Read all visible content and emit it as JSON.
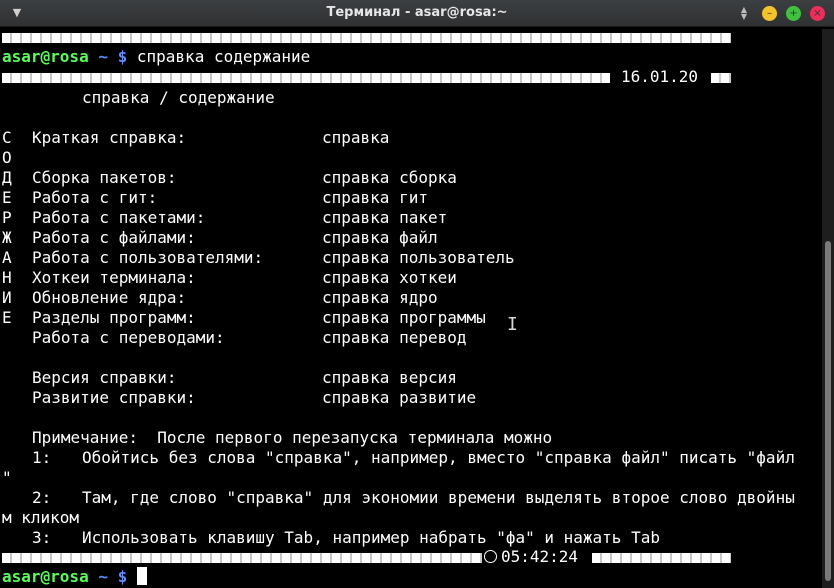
{
  "window": {
    "title": "Терминал - asar@rosa:~",
    "menu_icon": "chevron-down-icon",
    "minimize_icon": "minimize-icon",
    "maximize_icon": "maximize-icon",
    "close_icon": "close-icon",
    "colors": {
      "minimize": "#f5c227",
      "maximize": "#3fc33f",
      "close": "#ee2e5a"
    }
  },
  "terminal": {
    "prompt_user": "asar@rosa",
    "prompt_path": "~ $",
    "command": "справка содержание",
    "header_date": "16.01.20",
    "heading": "справка / содержание",
    "side_letters": [
      "С",
      "О",
      "Д",
      "Е",
      "Р",
      "Ж",
      "А",
      "Н",
      "И",
      "Е"
    ],
    "rows": [
      {
        "label": "Краткая справка:",
        "cmd": "справка"
      },
      {
        "label": "Сборка пакетов:",
        "cmd": "справка сборка"
      },
      {
        "label": "Работа с гит:",
        "cmd": "справка гит"
      },
      {
        "label": "Работа с пакетами:",
        "cmd": "справка пакет"
      },
      {
        "label": "Работа с файлами:",
        "cmd": "справка файл"
      },
      {
        "label": "Работа с пользователями:",
        "cmd": "справка пользователь"
      },
      {
        "label": "Хоткеи терминала:",
        "cmd": "справка хоткеи"
      },
      {
        "label": "Обновление ядра:",
        "cmd": "справка ядро"
      },
      {
        "label": "Разделы программ:",
        "cmd": "справка программы"
      },
      {
        "label": "Работа с переводами:",
        "cmd": "справка перевод"
      },
      {
        "label": "Версия справки:",
        "cmd": "справка версия"
      },
      {
        "label": "Развитие справки:",
        "cmd": "справка развитие"
      }
    ],
    "note_title": "Примечание:  После первого перезапуска терминала можно",
    "note_1_num": "1:",
    "note_1": "Обойтись без слова \"справка\", например, вместо \"справка файл\" писать \"файл",
    "note_1_wrap": "\"",
    "note_2_num": "2:",
    "note_2": "Там, где слово \"справка\" для экономии времени выделять второе слово двойны",
    "note_2_wrap": "м кликом",
    "note_3_num": "3:",
    "note_3": "Использовать клавишу Tab, например набрать \"фа\" и нажать Tab",
    "footer_time": "05:42:24",
    "footer_icon": "clock-icon",
    "second_prompt_user": "asar@rosa",
    "second_prompt_path": "~ $"
  }
}
